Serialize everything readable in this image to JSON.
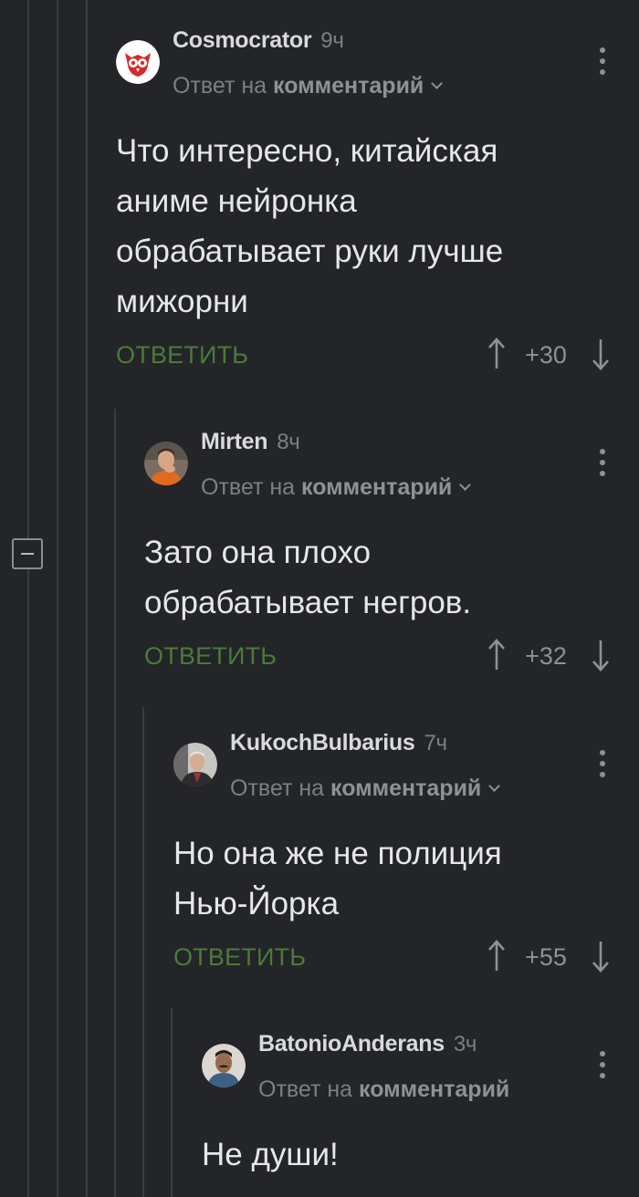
{
  "ui": {
    "reply_prefix": "Ответ на",
    "reply_target": "комментарий",
    "reply_button": "ОТВЕТИТЬ"
  },
  "comments": [
    {
      "author": "Cosmocrator",
      "time": "9ч",
      "text": "Что интересно, китайская\nаниме нейронка\nобрабатывает руки лучше\nмижорни",
      "score": "+30",
      "avatar": "owl-logo-avatar"
    },
    {
      "author": "Mirten",
      "time": "8ч",
      "text": "Зато она плохо\nобрабатывает негров.",
      "score": "+32",
      "avatar": "man-orange-shirt-avatar"
    },
    {
      "author": "KukochBulbarius",
      "time": "7ч",
      "text": "Но она же не полиция\nНью-Йорка",
      "score": "+55",
      "avatar": "man-suit-avatar"
    },
    {
      "author": "BatonioAnderans",
      "time": "3ч",
      "text": "Не души!",
      "score": "",
      "avatar": "man-mustache-avatar"
    }
  ],
  "colors": {
    "background": "#232528",
    "reply_green": "#4b7a3a",
    "thread_line": "#3a3d42"
  }
}
